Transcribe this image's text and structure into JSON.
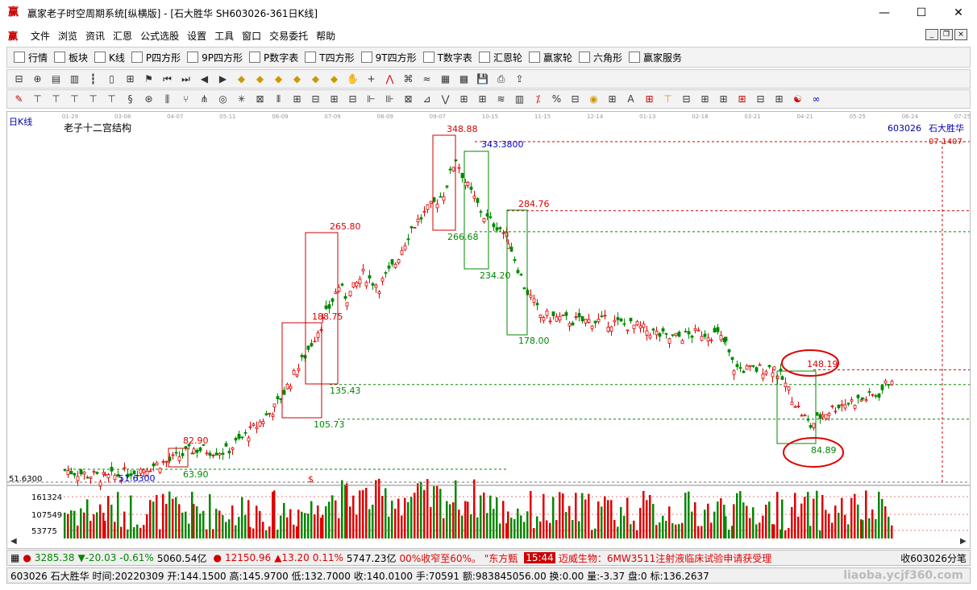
{
  "window": {
    "title": "赢家老子时空周期系统[纵横版] - [石大胜华  SH603026-361日K线]",
    "logo": "赢"
  },
  "menu": [
    "文件",
    "浏览",
    "资讯",
    "汇恩",
    "公式选股",
    "设置",
    "工具",
    "窗口",
    "交易委托",
    "帮助"
  ],
  "menu_logo": "赢",
  "toolbar1": [
    {
      "label": "行情",
      "icon": "grid-icon"
    },
    {
      "label": "板块",
      "icon": "blocks-icon"
    },
    {
      "label": "K线",
      "icon": "candles-icon"
    },
    {
      "label": "P四方形",
      "icon": "ps-icon"
    },
    {
      "label": "9P四方形",
      "icon": "p9-icon"
    },
    {
      "label": "P数字表",
      "icon": "pn-icon"
    },
    {
      "label": "T四方形",
      "icon": "ts-icon"
    },
    {
      "label": "9T四方形",
      "icon": "t9-icon"
    },
    {
      "label": "T数字表",
      "icon": "tn-icon"
    },
    {
      "label": "汇恩轮",
      "icon": "wheel-icon"
    },
    {
      "label": "赢家轮",
      "icon": "winner-wheel-icon"
    },
    {
      "label": "六角形",
      "icon": "hexagon-icon"
    },
    {
      "label": "赢家服务",
      "icon": "dollar-icon"
    }
  ],
  "chart": {
    "period_label": "日K线",
    "indicator_label": "老子十二宫结构",
    "stock_code": "603026",
    "stock_name": "石大胜华",
    "right_date": "07-1407-",
    "dates": [
      "01-29",
      "03-08",
      "04-07",
      "05-11",
      "06-09",
      "07-09",
      "08-09",
      "09-07",
      "10-15",
      "11-15",
      "12-14",
      "01-13",
      "02-18",
      "03-21",
      "04-21",
      "05-25",
      "06-24",
      "07-25"
    ],
    "left_price": "51.6300",
    "price_labels": [
      {
        "text": "348.88",
        "color": "#d00"
      },
      {
        "text": "343.3800",
        "color": "#00c"
      },
      {
        "text": "284.76",
        "color": "#d00"
      },
      {
        "text": "266.68",
        "color": "#080"
      },
      {
        "text": "265.80",
        "color": "#d00"
      },
      {
        "text": "234.20",
        "color": "#080"
      },
      {
        "text": "188.75",
        "color": "#d00"
      },
      {
        "text": "178.00",
        "color": "#080"
      },
      {
        "text": "148.19",
        "color": "#d00"
      },
      {
        "text": "135.43",
        "color": "#080"
      },
      {
        "text": "105.73",
        "color": "#080"
      },
      {
        "text": "84.89",
        "color": "#080"
      },
      {
        "text": "82.90",
        "color": "#d00"
      },
      {
        "text": "63.90",
        "color": "#080"
      },
      {
        "text": "51.6300",
        "color": "#00c"
      }
    ],
    "dollar_mark": "$",
    "volume_labels": [
      "161324",
      "107549",
      "53775"
    ]
  },
  "statusbar": {
    "index1_value": "3285.38",
    "index1_change": "▼-20.03",
    "index1_pct": "-0.61%",
    "index1_amount": "5060.54亿",
    "index2_value": "12150.96",
    "index2_change": "▲13.20",
    "index2_pct": "0.11%",
    "index2_amount": "5747.23亿",
    "ticker_text": "00%收窄至60%。  \"东方甄",
    "time": "15:44",
    "news": "迈威生物：6MW3511注射液临床试验申请获受理",
    "right_text": "收603026分笔"
  },
  "infobar": {
    "text": "603026 石大胜华 时间:20220309 开:144.1500 高:145.9700 低:132.7000 收:140.0100 手:70591 额:983845056.00 换:0.00 量:-3.37 盘:0 标:136.2637"
  },
  "watermark": "liaoba.ycjf360.com"
}
